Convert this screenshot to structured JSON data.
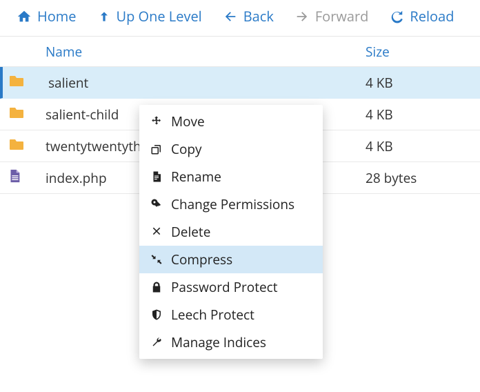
{
  "toolbar": {
    "home": "Home",
    "up": "Up One Level",
    "back": "Back",
    "forward": "Forward",
    "reload": "Reload"
  },
  "columns": {
    "name": "Name",
    "size": "Size"
  },
  "files": [
    {
      "name": "salient",
      "size": "4 KB",
      "type": "folder",
      "selected": true
    },
    {
      "name": "salient-child",
      "size": "4 KB",
      "type": "folder",
      "selected": false
    },
    {
      "name": "twentytwentythree",
      "size": "4 KB",
      "type": "folder",
      "selected": false
    },
    {
      "name": "index.php",
      "size": "28 bytes",
      "type": "file",
      "selected": false
    }
  ],
  "context_menu": {
    "items": [
      {
        "label": "Move",
        "icon": "move-icon",
        "highlighted": false
      },
      {
        "label": "Copy",
        "icon": "copy-icon",
        "highlighted": false
      },
      {
        "label": "Rename",
        "icon": "rename-icon",
        "highlighted": false
      },
      {
        "label": "Change Permissions",
        "icon": "key-icon",
        "highlighted": false
      },
      {
        "label": "Delete",
        "icon": "delete-icon",
        "highlighted": false
      },
      {
        "label": "Compress",
        "icon": "compress-icon",
        "highlighted": true
      },
      {
        "label": "Password Protect",
        "icon": "lock-icon",
        "highlighted": false
      },
      {
        "label": "Leech Protect",
        "icon": "shield-icon",
        "highlighted": false
      },
      {
        "label": "Manage Indices",
        "icon": "wrench-icon",
        "highlighted": false
      }
    ]
  }
}
